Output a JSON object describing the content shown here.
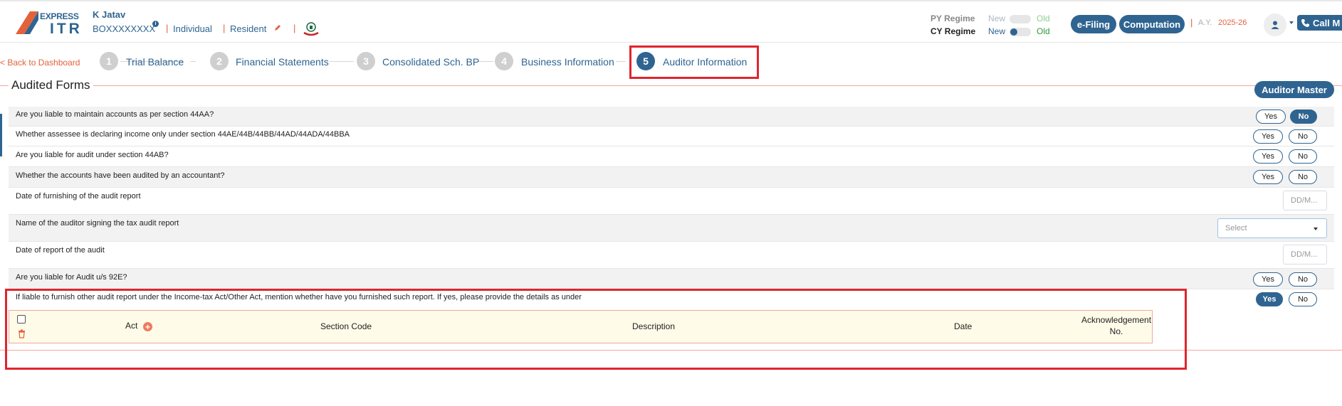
{
  "header": {
    "logo": {
      "line1": "EXPRESS",
      "line2": "ITR"
    },
    "user_name": "K Jatav",
    "pan": "BOXXXXXXXX",
    "info_icon": "info-icon",
    "status": "Individual",
    "residency": "Resident",
    "pencil_icon": "pencil-icon",
    "emblem_icon": "govt-emblem-icon",
    "py_regime_label": "PY Regime",
    "cy_regime_label": "CY Regime",
    "py_new": "New",
    "py_old": "Old",
    "cy_new": "New",
    "cy_old": "Old",
    "efiling": "e-Filing",
    "computation": "Computation",
    "ay_label": "A.Y.",
    "ay_value": "2025-26",
    "call_label": "Call M"
  },
  "steps": {
    "back": "< Back to Dashboard",
    "items": [
      {
        "num": "1",
        "label": "Trial Balance"
      },
      {
        "num": "2",
        "label": "Financial Statements"
      },
      {
        "num": "3",
        "label": "Consolidated Sch. BP"
      },
      {
        "num": "4",
        "label": "Business Information"
      },
      {
        "num": "5",
        "label": "Auditor Information"
      }
    ]
  },
  "section": {
    "title": "Audited Forms",
    "auditor_master": "Auditor Master"
  },
  "questions": [
    {
      "text": "Are you liable to maintain accounts as per section 44AA?",
      "answer": "No"
    },
    {
      "text": "Whether assessee is declaring income only under section 44AE/44B/44BB/44AD/44ADA/44BBA",
      "answer": ""
    },
    {
      "text": "Are you liable for audit under section 44AB?",
      "answer": ""
    },
    {
      "text": "Whether the accounts have been audited by an accountant?",
      "answer": ""
    },
    {
      "text": "Date of furnishing of the audit report",
      "placeholder": "DD/M..."
    },
    {
      "text": "Name of the auditor signing the tax audit report",
      "select": "Select"
    },
    {
      "text": "Date of report of the audit",
      "placeholder": "DD/M..."
    },
    {
      "text": "Are you liable for Audit u/s 92E?",
      "answer": ""
    },
    {
      "text": "If liable to furnish other audit report under the Income-tax Act/Other Act, mention whether have you furnished such report. If yes, please provide the details as under",
      "answer": "Yes"
    }
  ],
  "yes_label": "Yes",
  "no_label": "No",
  "table": {
    "columns": [
      "Act",
      "Section Code",
      "Description",
      "Date",
      "Acknowledgement No."
    ],
    "ack_line1": "Acknowledgement",
    "ack_line2": "No."
  },
  "colors": {
    "accent": "#2f6491",
    "highlight": "#e0252d",
    "orange": "#e2623b",
    "table_bg": "#fefbe8"
  }
}
